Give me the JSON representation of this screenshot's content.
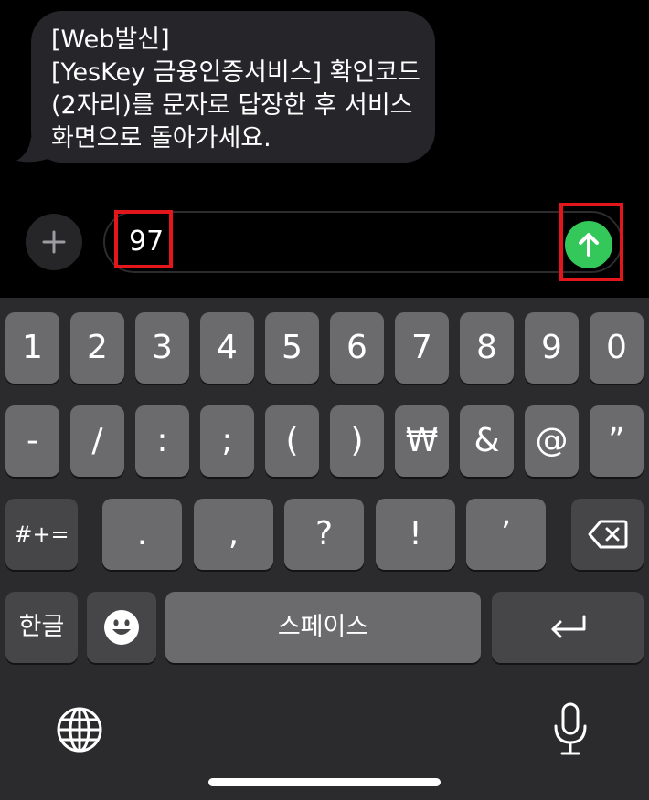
{
  "message": {
    "lines": [
      "[Web발신]",
      "[YesKey 금융인증서비스] 확인코드",
      "(2자리)를 문자로 답장한 후 서비스",
      "화면으로 돌아가세요."
    ]
  },
  "compose": {
    "input_value": "97",
    "add_icon": "plus-icon",
    "send_icon": "arrow-up-icon",
    "send_color": "#34c759",
    "highlight_color": "#e3161c"
  },
  "keyboard": {
    "row1": [
      "1",
      "2",
      "3",
      "4",
      "5",
      "6",
      "7",
      "8",
      "9",
      "0"
    ],
    "row2": [
      "-",
      "/",
      ":",
      ";",
      "(",
      ")",
      "₩",
      "&",
      "@",
      "”"
    ],
    "row3": {
      "left": "#+=",
      "keys": [
        ".",
        ",",
        "?",
        "!",
        "’"
      ],
      "right_icon": "backspace-icon"
    },
    "row4": {
      "lang": "한글",
      "emoji_icon": "emoji-icon",
      "space": "스페이스",
      "return_icon": "return-icon"
    },
    "bottom": {
      "globe_icon": "globe-icon",
      "mic_icon": "microphone-icon"
    }
  }
}
